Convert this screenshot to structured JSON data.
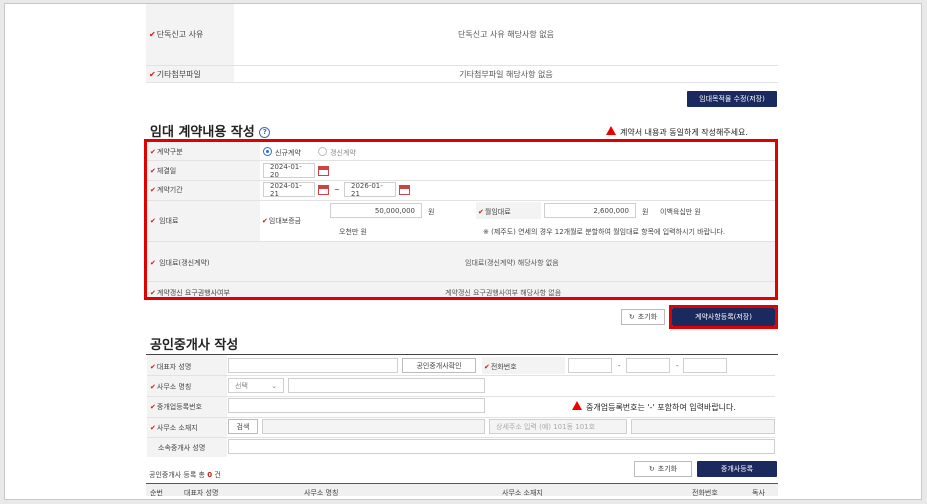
{
  "top": {
    "rows": [
      {
        "label": "단독신고 사유",
        "value": "단독신고 사유 해당사항 없음"
      },
      {
        "label": "기타첨부파일",
        "value": "기타첨부파일 해당사항 없음"
      }
    ],
    "modify_button": "임대목적물 수정(저장)"
  },
  "contract": {
    "title": "임대 계약내용 작성",
    "help_icon": "question-circle-icon",
    "warning": "계약서 내용과 동일하게 작성해주세요.",
    "type_label": "계약구분",
    "type_options": [
      "신규계약",
      "갱신계약"
    ],
    "selected_type": "신규계약",
    "signed_label": "체결일",
    "signed_date": "2024-01-20",
    "period_label": "계약기간",
    "period_start": "2024-01-21",
    "period_sep": "~",
    "period_end": "2026-01-21",
    "rent_label": "임대료",
    "deposit_label": "임대보증금",
    "deposit_value": "50,000,000",
    "deposit_unit": "원",
    "deposit_words": "오천만 원",
    "monthly_label": "월임대료",
    "monthly_value": "2,600,000",
    "monthly_unit": "원",
    "monthly_words": "이백육십만 원",
    "jeju_note": "※ (제주도) 연세의 경우 12개월로 분할하여 월임대료 항목에 입력하시기 바랍니다.",
    "renewal_rent_label": "임대료(갱신계약)",
    "renewal_rent_value": "임대료(갱신계약) 해당사항 없음",
    "renewal_right_label": "계약갱신 요구권행사여부",
    "renewal_right_value": "계약갱신 요구권행사여부 해당사항 없음",
    "reset_button": "초기화",
    "save_button": "계약사항등록(저장)"
  },
  "broker": {
    "title": "공인중개사 작성",
    "rep_label": "대표자 성명",
    "check_button": "공인중개사확인",
    "phone_label": "전화번호",
    "phone_sep1": "-",
    "phone_sep2": "-",
    "office_label": "사무소 명칭",
    "select_value": "선택",
    "reg_label": "중개업등록번호",
    "reg_warning": "중개업등록번호는 '-' 포함하여 입력바랍니다.",
    "address_label": "사무소 소재지",
    "search_button": "검색",
    "detail_placeholder": "상세주소 입력 (예) 101동 101호",
    "member_label": "소속중개사 성명",
    "count_prefix": "공인중개사 등록 총",
    "count_value": "0",
    "count_suffix": "건",
    "reset_button": "초기화",
    "register_button": "중개사등록",
    "table_headers": [
      "순번",
      "대표자 성명",
      "사무소 명칭",
      "사무소 소재지",
      "전화번호",
      "독사"
    ]
  },
  "colors": {
    "required": "#d01818",
    "navy": "#1b2a5e",
    "highlight": "#e00000"
  }
}
